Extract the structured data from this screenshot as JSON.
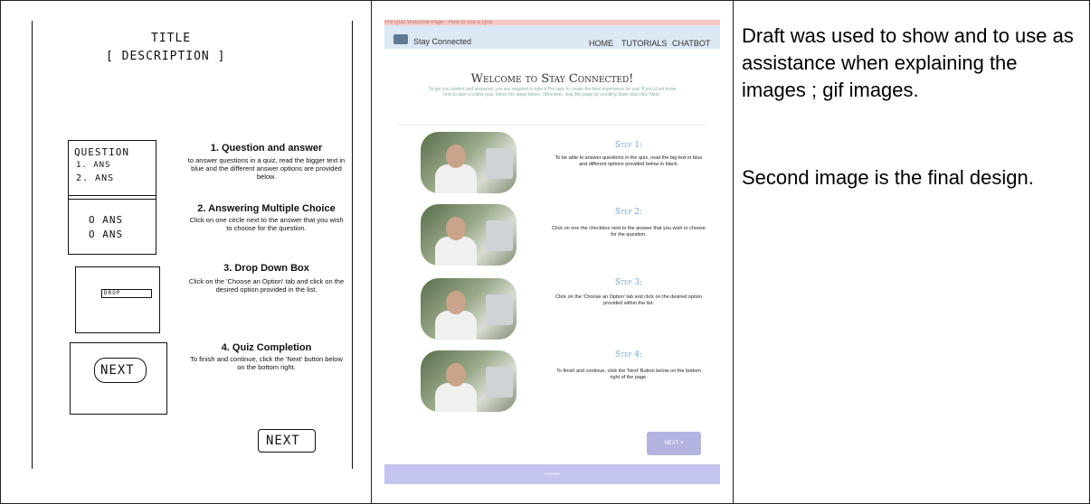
{
  "draft": {
    "title": "TITLE",
    "description": "[ DESCRIPTION ]",
    "box1": {
      "line1": "QUESTION",
      "line2": "1. ANS",
      "line3": "2. ANS"
    },
    "box2": {
      "line1": "O ANS",
      "line2": "O ANS"
    },
    "box3": {
      "label": "DROP"
    },
    "box4": {
      "label": "NEXT"
    },
    "steps": [
      {
        "title": "1. Question and answer",
        "body": "to answer questions in a quiz, read the bigger text in blue and the different answer options are provided below."
      },
      {
        "title": "2. Answering Multiple Choice",
        "body": "Click on one circle next to the answer that you wish to choose for the question."
      },
      {
        "title": "3. Drop Down Box",
        "body": "Click on the 'Choose an Option' tab and click on the desired option provided in the list."
      },
      {
        "title": "4. Quiz Completion",
        "body": "To finish and continue, click the 'Next' button below on the bottom right."
      }
    ],
    "next_button": "NEXT"
  },
  "final": {
    "page_tab_title": "Pre Quiz Welcome Page - How to use a Quiz",
    "brand": "Stay Connected",
    "nav": {
      "home": "HOME",
      "tutorials": "TUTORIALS",
      "chatbot": "CHATBOT"
    },
    "welcome_title": "Welcome to Stay Connected!",
    "welcome_sub": "To get you started and prepared, you are required to take a Pre quiz to create the best experience for you! If you d not know how to take a online quiz, follow the steps below. Otherwise, skip this page by scrolling down and click 'Next.'",
    "steps": [
      {
        "title": "Step 1:",
        "body": "To be able to answer questions in the quiz, read the big text in blue and different options provided below in black."
      },
      {
        "title": "Step 2:",
        "body": "Click on one the checkbox next to the answer that you wish to choose for the question."
      },
      {
        "title": "Step 3:",
        "body": "Click on the 'Choose an Option' tab and click on the desired option provided within the list."
      },
      {
        "title": "Step 4:",
        "body": "To finish and continue, click the 'Next' Button below on the bottom right of the page."
      }
    ],
    "next_label": "NEXT >",
    "footer": "FOOTER"
  },
  "notes": {
    "para1": "Draft was used to show and to use as assistance when explaining the images ; gif images.",
    "para2": "Second image is the final design."
  }
}
